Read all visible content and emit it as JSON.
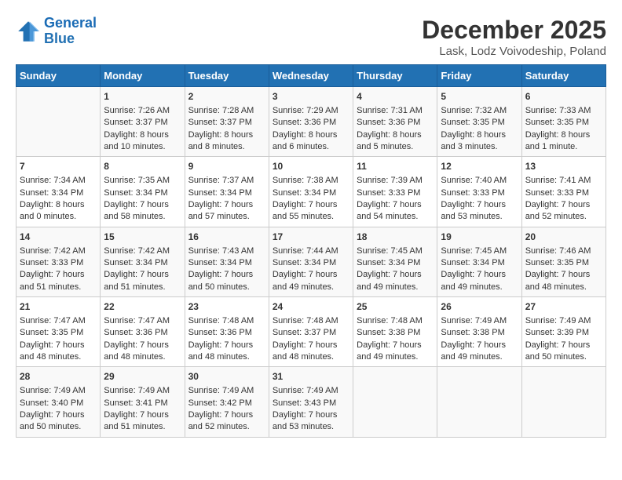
{
  "logo": {
    "line1": "General",
    "line2": "Blue"
  },
  "title": "December 2025",
  "subtitle": "Lask, Lodz Voivodeship, Poland",
  "days_of_week": [
    "Sunday",
    "Monday",
    "Tuesday",
    "Wednesday",
    "Thursday",
    "Friday",
    "Saturday"
  ],
  "weeks": [
    [
      {
        "day": "",
        "sunrise": "",
        "sunset": "",
        "daylight": ""
      },
      {
        "day": "1",
        "sunrise": "Sunrise: 7:26 AM",
        "sunset": "Sunset: 3:37 PM",
        "daylight": "Daylight: 8 hours and 10 minutes."
      },
      {
        "day": "2",
        "sunrise": "Sunrise: 7:28 AM",
        "sunset": "Sunset: 3:37 PM",
        "daylight": "Daylight: 8 hours and 8 minutes."
      },
      {
        "day": "3",
        "sunrise": "Sunrise: 7:29 AM",
        "sunset": "Sunset: 3:36 PM",
        "daylight": "Daylight: 8 hours and 6 minutes."
      },
      {
        "day": "4",
        "sunrise": "Sunrise: 7:31 AM",
        "sunset": "Sunset: 3:36 PM",
        "daylight": "Daylight: 8 hours and 5 minutes."
      },
      {
        "day": "5",
        "sunrise": "Sunrise: 7:32 AM",
        "sunset": "Sunset: 3:35 PM",
        "daylight": "Daylight: 8 hours and 3 minutes."
      },
      {
        "day": "6",
        "sunrise": "Sunrise: 7:33 AM",
        "sunset": "Sunset: 3:35 PM",
        "daylight": "Daylight: 8 hours and 1 minute."
      }
    ],
    [
      {
        "day": "7",
        "sunrise": "Sunrise: 7:34 AM",
        "sunset": "Sunset: 3:34 PM",
        "daylight": "Daylight: 8 hours and 0 minutes."
      },
      {
        "day": "8",
        "sunrise": "Sunrise: 7:35 AM",
        "sunset": "Sunset: 3:34 PM",
        "daylight": "Daylight: 7 hours and 58 minutes."
      },
      {
        "day": "9",
        "sunrise": "Sunrise: 7:37 AM",
        "sunset": "Sunset: 3:34 PM",
        "daylight": "Daylight: 7 hours and 57 minutes."
      },
      {
        "day": "10",
        "sunrise": "Sunrise: 7:38 AM",
        "sunset": "Sunset: 3:34 PM",
        "daylight": "Daylight: 7 hours and 55 minutes."
      },
      {
        "day": "11",
        "sunrise": "Sunrise: 7:39 AM",
        "sunset": "Sunset: 3:33 PM",
        "daylight": "Daylight: 7 hours and 54 minutes."
      },
      {
        "day": "12",
        "sunrise": "Sunrise: 7:40 AM",
        "sunset": "Sunset: 3:33 PM",
        "daylight": "Daylight: 7 hours and 53 minutes."
      },
      {
        "day": "13",
        "sunrise": "Sunrise: 7:41 AM",
        "sunset": "Sunset: 3:33 PM",
        "daylight": "Daylight: 7 hours and 52 minutes."
      }
    ],
    [
      {
        "day": "14",
        "sunrise": "Sunrise: 7:42 AM",
        "sunset": "Sunset: 3:33 PM",
        "daylight": "Daylight: 7 hours and 51 minutes."
      },
      {
        "day": "15",
        "sunrise": "Sunrise: 7:42 AM",
        "sunset": "Sunset: 3:34 PM",
        "daylight": "Daylight: 7 hours and 51 minutes."
      },
      {
        "day": "16",
        "sunrise": "Sunrise: 7:43 AM",
        "sunset": "Sunset: 3:34 PM",
        "daylight": "Daylight: 7 hours and 50 minutes."
      },
      {
        "day": "17",
        "sunrise": "Sunrise: 7:44 AM",
        "sunset": "Sunset: 3:34 PM",
        "daylight": "Daylight: 7 hours and 49 minutes."
      },
      {
        "day": "18",
        "sunrise": "Sunrise: 7:45 AM",
        "sunset": "Sunset: 3:34 PM",
        "daylight": "Daylight: 7 hours and 49 minutes."
      },
      {
        "day": "19",
        "sunrise": "Sunrise: 7:45 AM",
        "sunset": "Sunset: 3:34 PM",
        "daylight": "Daylight: 7 hours and 49 minutes."
      },
      {
        "day": "20",
        "sunrise": "Sunrise: 7:46 AM",
        "sunset": "Sunset: 3:35 PM",
        "daylight": "Daylight: 7 hours and 48 minutes."
      }
    ],
    [
      {
        "day": "21",
        "sunrise": "Sunrise: 7:47 AM",
        "sunset": "Sunset: 3:35 PM",
        "daylight": "Daylight: 7 hours and 48 minutes."
      },
      {
        "day": "22",
        "sunrise": "Sunrise: 7:47 AM",
        "sunset": "Sunset: 3:36 PM",
        "daylight": "Daylight: 7 hours and 48 minutes."
      },
      {
        "day": "23",
        "sunrise": "Sunrise: 7:48 AM",
        "sunset": "Sunset: 3:36 PM",
        "daylight": "Daylight: 7 hours and 48 minutes."
      },
      {
        "day": "24",
        "sunrise": "Sunrise: 7:48 AM",
        "sunset": "Sunset: 3:37 PM",
        "daylight": "Daylight: 7 hours and 48 minutes."
      },
      {
        "day": "25",
        "sunrise": "Sunrise: 7:48 AM",
        "sunset": "Sunset: 3:38 PM",
        "daylight": "Daylight: 7 hours and 49 minutes."
      },
      {
        "day": "26",
        "sunrise": "Sunrise: 7:49 AM",
        "sunset": "Sunset: 3:38 PM",
        "daylight": "Daylight: 7 hours and 49 minutes."
      },
      {
        "day": "27",
        "sunrise": "Sunrise: 7:49 AM",
        "sunset": "Sunset: 3:39 PM",
        "daylight": "Daylight: 7 hours and 50 minutes."
      }
    ],
    [
      {
        "day": "28",
        "sunrise": "Sunrise: 7:49 AM",
        "sunset": "Sunset: 3:40 PM",
        "daylight": "Daylight: 7 hours and 50 minutes."
      },
      {
        "day": "29",
        "sunrise": "Sunrise: 7:49 AM",
        "sunset": "Sunset: 3:41 PM",
        "daylight": "Daylight: 7 hours and 51 minutes."
      },
      {
        "day": "30",
        "sunrise": "Sunrise: 7:49 AM",
        "sunset": "Sunset: 3:42 PM",
        "daylight": "Daylight: 7 hours and 52 minutes."
      },
      {
        "day": "31",
        "sunrise": "Sunrise: 7:49 AM",
        "sunset": "Sunset: 3:43 PM",
        "daylight": "Daylight: 7 hours and 53 minutes."
      },
      {
        "day": "",
        "sunrise": "",
        "sunset": "",
        "daylight": ""
      },
      {
        "day": "",
        "sunrise": "",
        "sunset": "",
        "daylight": ""
      },
      {
        "day": "",
        "sunrise": "",
        "sunset": "",
        "daylight": ""
      }
    ]
  ]
}
